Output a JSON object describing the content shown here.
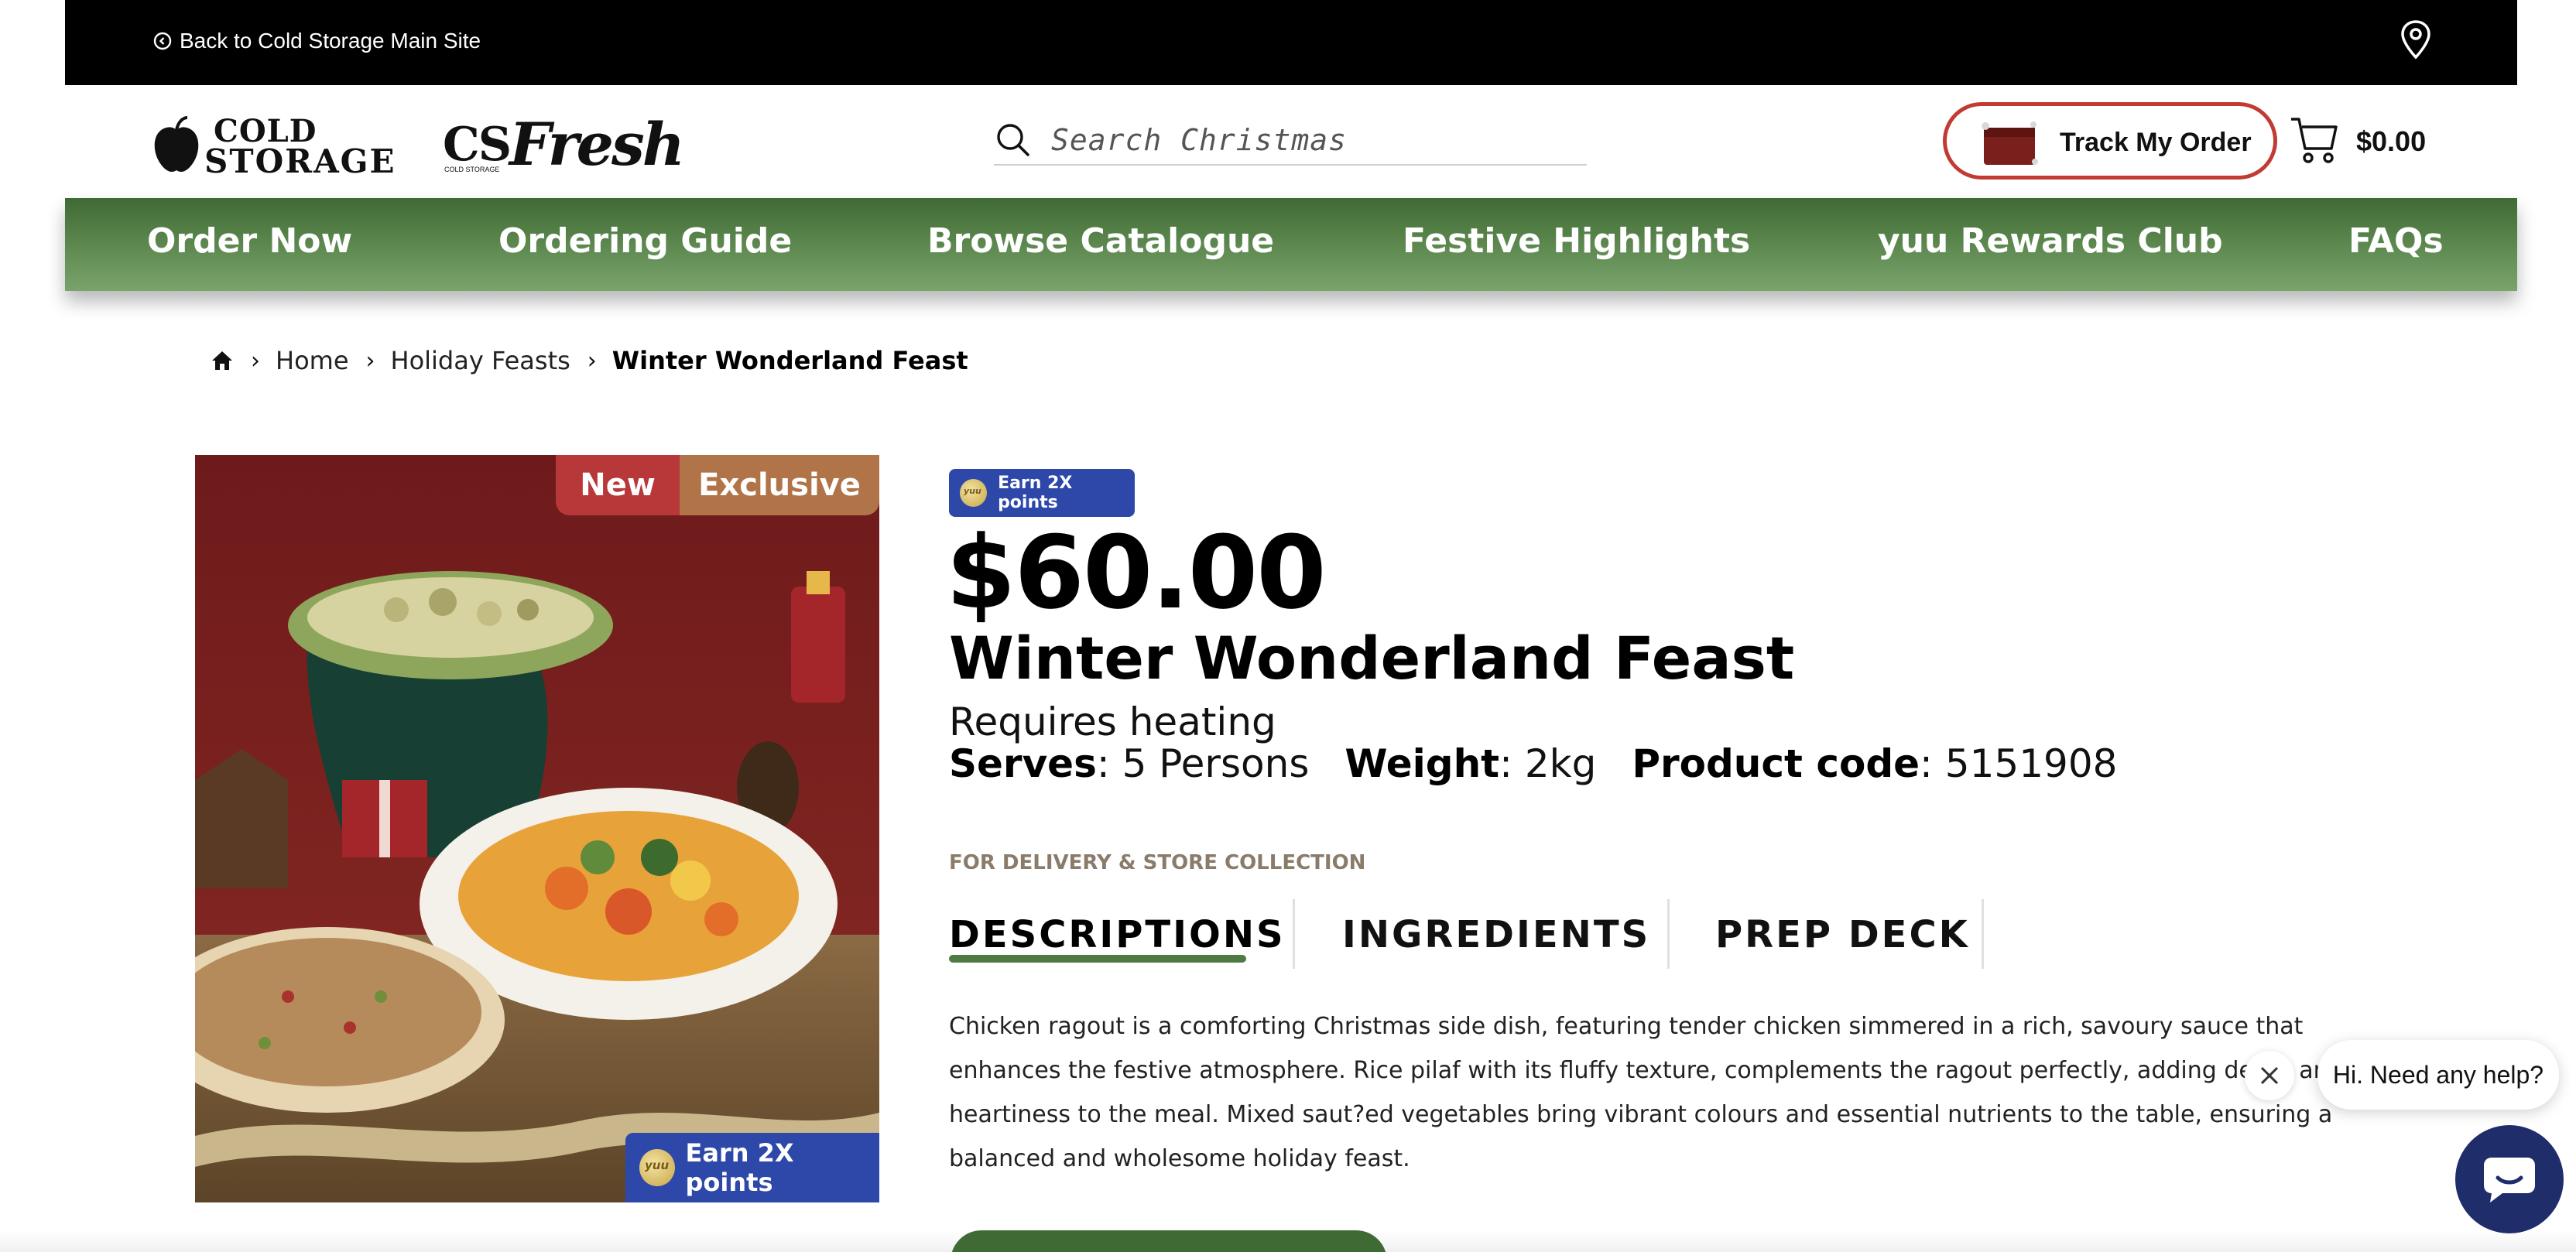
{
  "topbar": {
    "back_label": "Back to Cold Storage Main Site",
    "back_icon": "back-arrow-circle-icon",
    "location_icon": "map-pin-icon"
  },
  "header": {
    "logo_line1": "COLD",
    "logo_line2": "STORAGE",
    "fresh_prefix": "CS",
    "fresh_word": "Fresh",
    "fresh_sub": "COLD STORAGE",
    "search_placeholder": "Search Christmas",
    "track_label": "Track My Order",
    "cart_total": "$0.00",
    "accent_color": "#c23b33"
  },
  "nav": {
    "items": [
      "Order Now",
      "Ordering Guide",
      "Browse Catalogue",
      "Festive Highlights",
      "yuu Rewards Club",
      "FAQs"
    ],
    "color": "#4f7a44"
  },
  "breadcrumb": {
    "items": [
      "Home",
      "Holiday Feasts",
      "Winter Wonderland Feast"
    ]
  },
  "product": {
    "badge_new": "New",
    "badge_exclusive": "Exclusive",
    "image_points": "Earn 2X points",
    "points_chip": "Earn 2X points",
    "price": "$60.00",
    "title": "Winter Wonderland Feast",
    "heating": "Requires heating",
    "serves_label": "Serves",
    "serves_value": ": 5 Persons",
    "weight_label": "Weight",
    "weight_value": ": 2kg",
    "code_label": "Product code",
    "code_value": ": 5151908",
    "delivery": "FOR DELIVERY & STORE COLLECTION",
    "tabs": [
      "DESCRIPTIONS",
      "INGREDIENTS",
      "PREP DECK"
    ],
    "active_tab": "DESCRIPTIONS",
    "description": "Chicken ragout is a comforting Christmas side dish, featuring tender chicken simmered in a rich, savoury sauce that enhances the festive atmosphere. Rice pilaf with its fluffy texture, complements the ragout perfectly, adding depth and heartiness to the meal. Mixed saut?ed vegetables bring vibrant colours and essential nutrients to the table, ensuring a balanced and wholesome holiday feast."
  },
  "help": {
    "bubble": "Hi. Need any help?",
    "close_icon": "close-icon",
    "chat_icon": "chat-bubble-icon"
  }
}
